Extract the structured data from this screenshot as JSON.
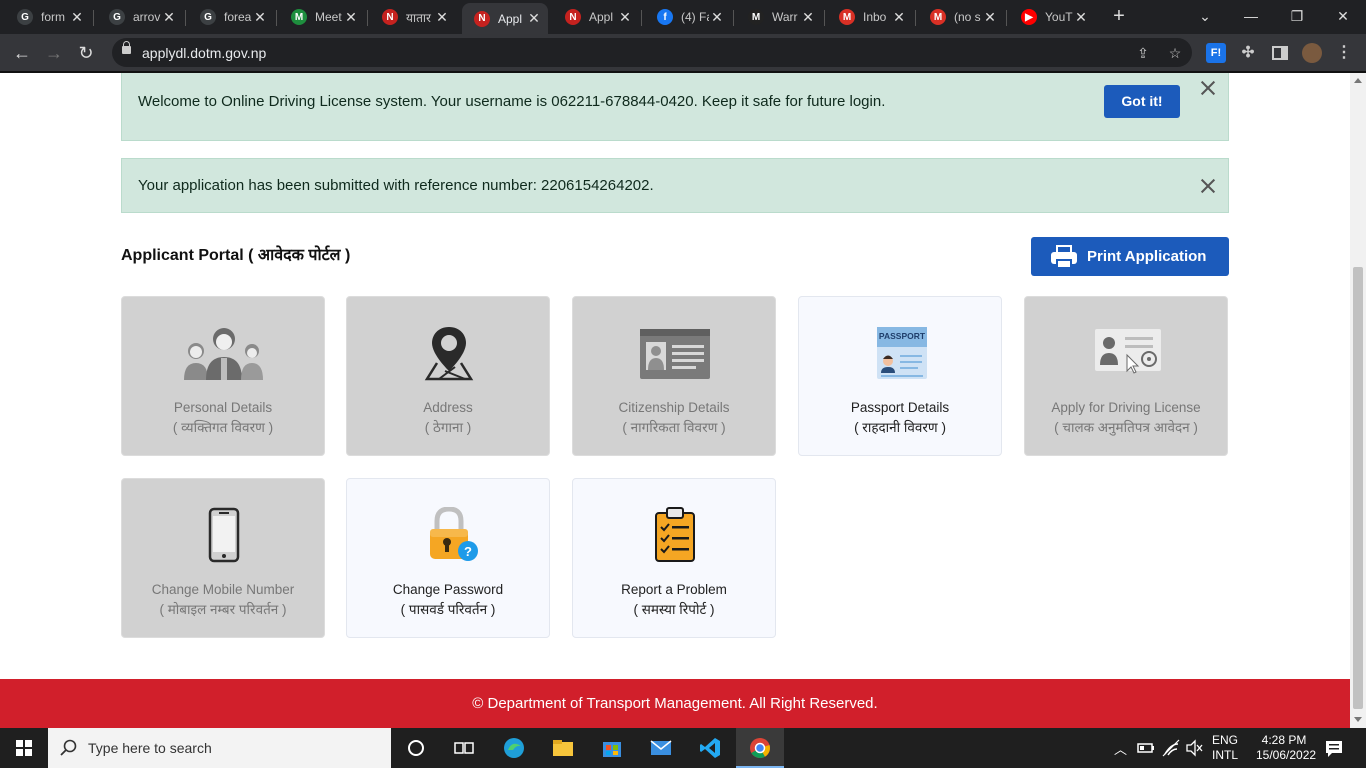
{
  "browser": {
    "tabs": [
      {
        "label": "form",
        "fav": "G",
        "color": "#3c4043"
      },
      {
        "label": "arrov",
        "fav": "G",
        "color": "#3c4043"
      },
      {
        "label": "forea",
        "fav": "G",
        "color": "#3c4043"
      },
      {
        "label": "Meet",
        "fav": "M",
        "color": "#1e8e3e"
      },
      {
        "label": "यातार",
        "fav": "N",
        "color": "#c5221f"
      },
      {
        "label": "Appl",
        "fav": "N",
        "color": "#c5221f"
      },
      {
        "label": "Appl",
        "fav": "N",
        "color": "#c5221f"
      },
      {
        "label": "(4) Fa",
        "fav": "f",
        "color": "#1877f2"
      },
      {
        "label": "Warr",
        "fav": "M",
        "color": "#222"
      },
      {
        "label": "Inbo",
        "fav": "M",
        "color": "#d93025"
      },
      {
        "label": "(no s",
        "fav": "M",
        "color": "#d93025"
      },
      {
        "label": "YouT",
        "fav": "▶",
        "color": "#ff0000"
      }
    ],
    "active_tab_index": 5,
    "url": "applydl.dotm.gov.np",
    "extension_label": "F!"
  },
  "alerts": {
    "welcome": "Welcome to Online Driving License system. Your username is 062211-678844-0420. Keep it safe for future login.",
    "got_it": "Got it!",
    "submitted": "Your application has been submitted with reference number: 2206154264202."
  },
  "portal": {
    "title": "Applicant Portal ( आवेदक पोर्टल )",
    "print_button": "Print Application",
    "cards": [
      {
        "label": "Personal Details",
        "sub": "( व्यक्तिगत विवरण )",
        "enabled": false,
        "icon": "family-icon"
      },
      {
        "label": "Address",
        "sub": "( ठेगाना )",
        "enabled": false,
        "icon": "map-pin-icon"
      },
      {
        "label": "Citizenship Details",
        "sub": "( नागरिकता विवरण )",
        "enabled": false,
        "icon": "id-card-icon"
      },
      {
        "label": "Passport Details",
        "sub": "( राहदानी विवरण )",
        "enabled": true,
        "icon": "passport-icon",
        "icon_text": "PASSPORT"
      },
      {
        "label": "Apply for Driving License",
        "sub": "( चालक अनुमतिपत्र आवेदन )",
        "enabled": false,
        "icon": "license-icon"
      },
      {
        "label": "Change Mobile Number",
        "sub": "( मोबाइल नम्बर परिवर्तन )",
        "enabled": false,
        "icon": "mobile-phone-icon"
      },
      {
        "label": "Change Password",
        "sub": "( पासवर्ड परिवर्तन )",
        "enabled": true,
        "icon": "padlock-icon",
        "icon_text": "?"
      },
      {
        "label": "Report a Problem",
        "sub": "( समस्या रिपोर्ट )",
        "enabled": true,
        "icon": "clipboard-icon"
      }
    ]
  },
  "footer": {
    "text": "© Department of Transport Management. All Right Reserved."
  },
  "taskbar": {
    "search_placeholder": "Type here to search",
    "lang1": "ENG",
    "lang2": "INTL",
    "time": "4:28 PM",
    "date": "15/06/2022"
  }
}
